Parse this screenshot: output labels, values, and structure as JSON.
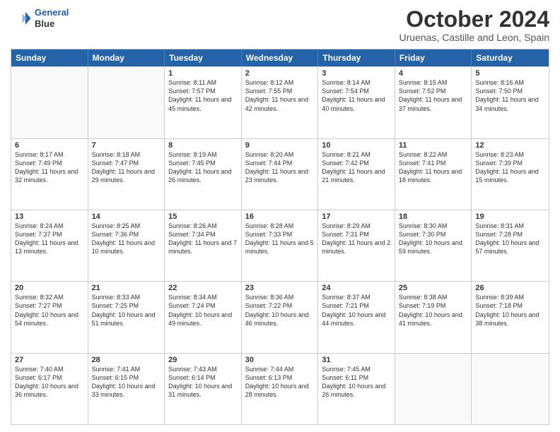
{
  "header": {
    "logo_line1": "General",
    "logo_line2": "Blue",
    "month": "October 2024",
    "location": "Uruenas, Castille and Leon, Spain"
  },
  "days_of_week": [
    "Sunday",
    "Monday",
    "Tuesday",
    "Wednesday",
    "Thursday",
    "Friday",
    "Saturday"
  ],
  "rows": [
    [
      {
        "day": "",
        "info": ""
      },
      {
        "day": "",
        "info": ""
      },
      {
        "day": "1",
        "info": "Sunrise: 8:11 AM\nSunset: 7:57 PM\nDaylight: 11 hours and 45 minutes."
      },
      {
        "day": "2",
        "info": "Sunrise: 8:12 AM\nSunset: 7:55 PM\nDaylight: 11 hours and 42 minutes."
      },
      {
        "day": "3",
        "info": "Sunrise: 8:14 AM\nSunset: 7:54 PM\nDaylight: 11 hours and 40 minutes."
      },
      {
        "day": "4",
        "info": "Sunrise: 8:15 AM\nSunset: 7:52 PM\nDaylight: 11 hours and 37 minutes."
      },
      {
        "day": "5",
        "info": "Sunrise: 8:16 AM\nSunset: 7:50 PM\nDaylight: 11 hours and 34 minutes."
      }
    ],
    [
      {
        "day": "6",
        "info": "Sunrise: 8:17 AM\nSunset: 7:49 PM\nDaylight: 11 hours and 32 minutes."
      },
      {
        "day": "7",
        "info": "Sunrise: 8:18 AM\nSunset: 7:47 PM\nDaylight: 11 hours and 29 minutes."
      },
      {
        "day": "8",
        "info": "Sunrise: 8:19 AM\nSunset: 7:45 PM\nDaylight: 11 hours and 26 minutes."
      },
      {
        "day": "9",
        "info": "Sunrise: 8:20 AM\nSunset: 7:44 PM\nDaylight: 11 hours and 23 minutes."
      },
      {
        "day": "10",
        "info": "Sunrise: 8:21 AM\nSunset: 7:42 PM\nDaylight: 11 hours and 21 minutes."
      },
      {
        "day": "11",
        "info": "Sunrise: 8:22 AM\nSunset: 7:41 PM\nDaylight: 11 hours and 18 minutes."
      },
      {
        "day": "12",
        "info": "Sunrise: 8:23 AM\nSunset: 7:39 PM\nDaylight: 11 hours and 15 minutes."
      }
    ],
    [
      {
        "day": "13",
        "info": "Sunrise: 8:24 AM\nSunset: 7:37 PM\nDaylight: 11 hours and 13 minutes."
      },
      {
        "day": "14",
        "info": "Sunrise: 8:25 AM\nSunset: 7:36 PM\nDaylight: 11 hours and 10 minutes."
      },
      {
        "day": "15",
        "info": "Sunrise: 8:26 AM\nSunset: 7:34 PM\nDaylight: 11 hours and 7 minutes."
      },
      {
        "day": "16",
        "info": "Sunrise: 8:28 AM\nSunset: 7:33 PM\nDaylight: 11 hours and 5 minutes."
      },
      {
        "day": "17",
        "info": "Sunrise: 8:29 AM\nSunset: 7:31 PM\nDaylight: 11 hours and 2 minutes."
      },
      {
        "day": "18",
        "info": "Sunrise: 8:30 AM\nSunset: 7:30 PM\nDaylight: 10 hours and 59 minutes."
      },
      {
        "day": "19",
        "info": "Sunrise: 8:31 AM\nSunset: 7:28 PM\nDaylight: 10 hours and 57 minutes."
      }
    ],
    [
      {
        "day": "20",
        "info": "Sunrise: 8:32 AM\nSunset: 7:27 PM\nDaylight: 10 hours and 54 minutes."
      },
      {
        "day": "21",
        "info": "Sunrise: 8:33 AM\nSunset: 7:25 PM\nDaylight: 10 hours and 51 minutes."
      },
      {
        "day": "22",
        "info": "Sunrise: 8:34 AM\nSunset: 7:24 PM\nDaylight: 10 hours and 49 minutes."
      },
      {
        "day": "23",
        "info": "Sunrise: 8:36 AM\nSunset: 7:22 PM\nDaylight: 10 hours and 46 minutes."
      },
      {
        "day": "24",
        "info": "Sunrise: 8:37 AM\nSunset: 7:21 PM\nDaylight: 10 hours and 44 minutes."
      },
      {
        "day": "25",
        "info": "Sunrise: 8:38 AM\nSunset: 7:19 PM\nDaylight: 10 hours and 41 minutes."
      },
      {
        "day": "26",
        "info": "Sunrise: 8:39 AM\nSunset: 7:18 PM\nDaylight: 10 hours and 38 minutes."
      }
    ],
    [
      {
        "day": "27",
        "info": "Sunrise: 7:40 AM\nSunset: 6:17 PM\nDaylight: 10 hours and 36 minutes."
      },
      {
        "day": "28",
        "info": "Sunrise: 7:41 AM\nSunset: 6:15 PM\nDaylight: 10 hours and 33 minutes."
      },
      {
        "day": "29",
        "info": "Sunrise: 7:43 AM\nSunset: 6:14 PM\nDaylight: 10 hours and 31 minutes."
      },
      {
        "day": "30",
        "info": "Sunrise: 7:44 AM\nSunset: 6:13 PM\nDaylight: 10 hours and 28 minutes."
      },
      {
        "day": "31",
        "info": "Sunrise: 7:45 AM\nSunset: 6:11 PM\nDaylight: 10 hours and 26 minutes."
      },
      {
        "day": "",
        "info": ""
      },
      {
        "day": "",
        "info": ""
      }
    ]
  ]
}
